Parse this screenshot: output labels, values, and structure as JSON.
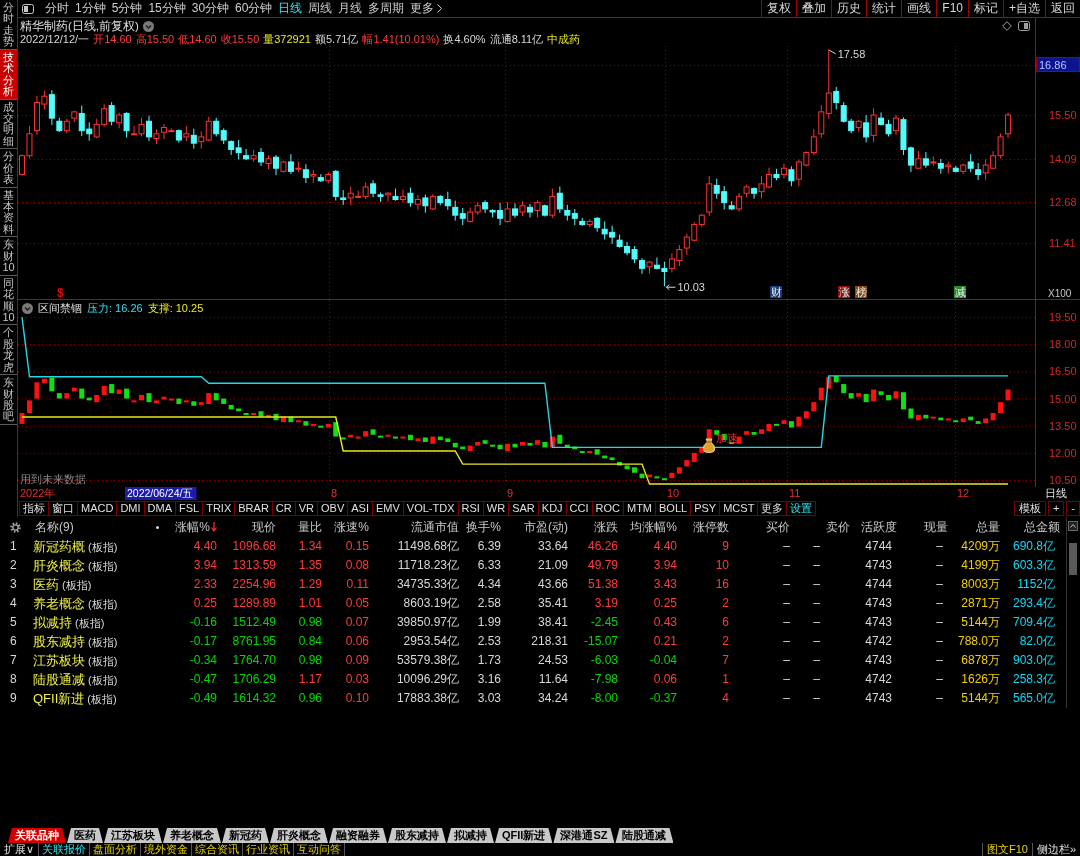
{
  "side_tabs": [
    {
      "label": "分时走势",
      "selected": false
    },
    {
      "label": "技术分析",
      "selected": true
    },
    {
      "label": "成交明细",
      "selected": false
    },
    {
      "label": "分价表",
      "selected": false
    },
    {
      "label": "基本资料",
      "selected": false
    },
    {
      "label": "东财10",
      "selected": false
    },
    {
      "label": "同花顺10",
      "selected": false
    },
    {
      "label": "个股龙虎",
      "selected": false
    },
    {
      "label": "东财股吧",
      "selected": false
    }
  ],
  "toolbar": {
    "periods": [
      {
        "label": "分时",
        "selected": false,
        "kind": "period"
      },
      {
        "label": "1分钟",
        "selected": false,
        "kind": "period"
      },
      {
        "label": "5分钟",
        "selected": false,
        "kind": "period"
      },
      {
        "label": "15分钟",
        "selected": false,
        "kind": "period"
      },
      {
        "label": "30分钟",
        "selected": false,
        "kind": "period"
      },
      {
        "label": "60分钟",
        "selected": false,
        "kind": "period"
      },
      {
        "label": "日线",
        "selected": true,
        "kind": "period"
      },
      {
        "label": "周线",
        "selected": false,
        "kind": "period"
      },
      {
        "label": "月线",
        "selected": false,
        "kind": "period"
      },
      {
        "label": "多周期",
        "selected": false,
        "kind": "period"
      },
      {
        "label": "更多",
        "selected": false,
        "kind": "menu"
      }
    ],
    "buttons": [
      "复权",
      "叠加",
      "历史",
      "统计",
      "画线",
      "F10",
      "标记",
      "+自选",
      "返回"
    ]
  },
  "quote": {
    "title": "精华制药(日线,前复权)",
    "fields": [
      {
        "text": "2022/12/12/一",
        "kind": "plain"
      },
      {
        "text": "开14.60",
        "kind": "up"
      },
      {
        "text": "高15.50",
        "kind": "up"
      },
      {
        "text": "低14.60",
        "kind": "up"
      },
      {
        "text": "收15.50",
        "kind": "up"
      },
      {
        "text": "量372921",
        "kind": "volume"
      },
      {
        "text": "额5.71亿",
        "kind": "plain"
      },
      {
        "text": "幅1.41(10.01%)",
        "kind": "up"
      },
      {
        "text": "换4.60%",
        "kind": "plain"
      },
      {
        "text": "流通8.11亿",
        "kind": "plain"
      },
      {
        "text": "中成药",
        "kind": "sector"
      }
    ]
  },
  "main_chart": {
    "axis_labels": [
      {
        "text": "16.86",
        "highlighted": true
      },
      {
        "text": "15.50",
        "highlighted": false
      },
      {
        "text": "14.09",
        "highlighted": false
      },
      {
        "text": "12.68",
        "highlighted": false
      },
      {
        "text": "11.41",
        "highlighted": false
      }
    ],
    "high_label": "17.58",
    "low_label": "10.03",
    "markers": [
      {
        "text": "$",
        "color": "#e00000",
        "kind": "glyph"
      },
      {
        "text": "财",
        "color": "#1a3c78",
        "kind": "badge"
      },
      {
        "text": "涨",
        "color": "#8a1010",
        "kind": "badge"
      },
      {
        "text": "榜",
        "color": "#8a4a10",
        "kind": "badge"
      },
      {
        "text": "减",
        "color": "#2a8a2a",
        "kind": "badge"
      }
    ],
    "scale": "X100"
  },
  "indicator": {
    "name": "区间禁锢",
    "resistance": "压力: 16.26",
    "support": "支撑: 10.25",
    "signal": "加速",
    "note": "用到未来数据",
    "axis_labels": [
      "19.50",
      "18.00",
      "16.50",
      "15.00",
      "13.50",
      "12.00",
      "10.50"
    ]
  },
  "date_axis": {
    "year": "2022年",
    "cursor": "2022/06/24/五",
    "months": [
      "8",
      "9",
      "10",
      "11",
      "12"
    ],
    "period": "日线"
  },
  "indicator_tabs": [
    {
      "label": "指标",
      "kind": "tab"
    },
    {
      "label": "窗口",
      "kind": "tab"
    },
    {
      "label": "MACD",
      "kind": "tab"
    },
    {
      "label": "DMI",
      "kind": "tab"
    },
    {
      "label": "DMA",
      "kind": "tab"
    },
    {
      "label": "FSL",
      "kind": "tab"
    },
    {
      "label": "TRIX",
      "kind": "tab"
    },
    {
      "label": "BRAR",
      "kind": "tab"
    },
    {
      "label": "CR",
      "kind": "tab"
    },
    {
      "label": "VR",
      "kind": "tab"
    },
    {
      "label": "OBV",
      "kind": "tab"
    },
    {
      "label": "ASI",
      "kind": "tab"
    },
    {
      "label": "EMV",
      "kind": "tab"
    },
    {
      "label": "VOL-TDX",
      "kind": "tab"
    },
    {
      "label": "RSI",
      "kind": "tab"
    },
    {
      "label": "WR",
      "kind": "tab"
    },
    {
      "label": "SAR",
      "kind": "tab"
    },
    {
      "label": "KDJ",
      "kind": "tab"
    },
    {
      "label": "CCI",
      "kind": "tab"
    },
    {
      "label": "ROC",
      "kind": "tab"
    },
    {
      "label": "MTM",
      "kind": "tab"
    },
    {
      "label": "BOLL",
      "kind": "tab"
    },
    {
      "label": "PSY",
      "kind": "tab"
    },
    {
      "label": "MCST",
      "kind": "tab"
    },
    {
      "label": "更多",
      "kind": "tab"
    },
    {
      "label": "设置",
      "kind": "setting"
    }
  ],
  "template_buttons": [
    "模板",
    "+",
    "-"
  ],
  "table": {
    "columns": [
      {
        "label": "名称(9)",
        "kind": "name",
        "sorted": false
      },
      {
        "label": "涨幅%",
        "kind": "trend",
        "sorted": true
      },
      {
        "label": "现价",
        "kind": "trend",
        "sorted": false
      },
      {
        "label": "量比",
        "kind": "ratio",
        "sorted": false
      },
      {
        "label": "涨速%",
        "kind": "rise",
        "sorted": false
      },
      {
        "label": "流通市值",
        "kind": "plain",
        "sorted": false
      },
      {
        "label": "换手%",
        "kind": "plain",
        "sorted": false
      },
      {
        "label": "市盈(动)",
        "kind": "plain",
        "sorted": false
      },
      {
        "label": "涨跌",
        "kind": "trend",
        "sorted": false
      },
      {
        "label": "均涨幅%",
        "kind": "avg",
        "sorted": false
      },
      {
        "label": "涨停数",
        "kind": "rise",
        "sorted": false
      },
      {
        "label": "买价",
        "kind": "plain",
        "sorted": false
      },
      {
        "label": "卖价",
        "kind": "plain",
        "sorted": false
      },
      {
        "label": "活跃度",
        "kind": "plain",
        "sorted": false
      },
      {
        "label": "现量",
        "kind": "plain",
        "sorted": false
      },
      {
        "label": "总量",
        "kind": "volume",
        "sorted": false
      },
      {
        "label": "总金额",
        "kind": "amount",
        "sorted": false
      }
    ],
    "rows": [
      {
        "no": "1",
        "name": "新冠药概",
        "tag": "(板指)",
        "up": true,
        "ratio_up": true,
        "avg_up": true,
        "values": [
          "4.40",
          "1096.68",
          "1.34",
          "0.15",
          "11498.68亿",
          "6.39",
          "33.64",
          "46.26",
          "4.40",
          "9",
          "–",
          "–",
          "4744",
          "–",
          "4209万",
          "690.8亿"
        ]
      },
      {
        "no": "2",
        "name": "肝炎概念",
        "tag": "(板指)",
        "up": true,
        "ratio_up": true,
        "avg_up": true,
        "values": [
          "3.94",
          "1313.59",
          "1.35",
          "0.08",
          "11718.23亿",
          "6.33",
          "21.09",
          "49.79",
          "3.94",
          "10",
          "–",
          "–",
          "4743",
          "–",
          "4199万",
          "603.3亿"
        ]
      },
      {
        "no": "3",
        "name": "医药",
        "tag": "(板指)",
        "up": true,
        "ratio_up": true,
        "avg_up": true,
        "values": [
          "2.33",
          "2254.96",
          "1.29",
          "0.11",
          "34735.33亿",
          "4.34",
          "43.66",
          "51.38",
          "3.43",
          "16",
          "–",
          "–",
          "4744",
          "–",
          "8003万",
          "1152亿"
        ]
      },
      {
        "no": "4",
        "name": "养老概念",
        "tag": "(板指)",
        "up": true,
        "ratio_up": true,
        "avg_up": true,
        "values": [
          "0.25",
          "1289.89",
          "1.01",
          "0.05",
          "8603.19亿",
          "2.58",
          "35.41",
          "3.19",
          "0.25",
          "2",
          "–",
          "–",
          "4743",
          "–",
          "2871万",
          "293.4亿"
        ]
      },
      {
        "no": "5",
        "name": "拟减持",
        "tag": "(板指)",
        "up": false,
        "ratio_up": false,
        "avg_up": true,
        "values": [
          "-0.16",
          "1512.49",
          "0.98",
          "0.07",
          "39850.97亿",
          "1.99",
          "38.41",
          "-2.45",
          "0.43",
          "6",
          "–",
          "–",
          "4743",
          "–",
          "5144万",
          "709.4亿"
        ]
      },
      {
        "no": "6",
        "name": "股东减持",
        "tag": "(板指)",
        "up": false,
        "ratio_up": false,
        "avg_up": true,
        "values": [
          "-0.17",
          "8761.95",
          "0.84",
          "0.06",
          "2953.54亿",
          "2.53",
          "218.31",
          "-15.07",
          "0.21",
          "2",
          "–",
          "–",
          "4742",
          "–",
          "788.0万",
          "82.0亿"
        ]
      },
      {
        "no": "7",
        "name": "江苏板块",
        "tag": "(板指)",
        "up": false,
        "ratio_up": false,
        "avg_up": false,
        "values": [
          "-0.34",
          "1764.70",
          "0.98",
          "0.09",
          "53579.38亿",
          "1.73",
          "24.53",
          "-6.03",
          "-0.04",
          "7",
          "–",
          "–",
          "4743",
          "–",
          "6878万",
          "903.0亿"
        ]
      },
      {
        "no": "8",
        "name": "陆股通减",
        "tag": "(板指)",
        "up": false,
        "ratio_up": true,
        "avg_up": true,
        "values": [
          "-0.47",
          "1706.29",
          "1.17",
          "0.03",
          "10096.29亿",
          "3.16",
          "11.64",
          "-7.98",
          "0.06",
          "1",
          "–",
          "–",
          "4742",
          "–",
          "1626万",
          "258.3亿"
        ]
      },
      {
        "no": "9",
        "name": "QFII新进",
        "tag": "(板指)",
        "up": false,
        "ratio_up": false,
        "avg_up": false,
        "values": [
          "-0.49",
          "1614.32",
          "0.96",
          "0.10",
          "17883.38亿",
          "3.03",
          "34.24",
          "-8.00",
          "-0.37",
          "4",
          "–",
          "–",
          "4743",
          "–",
          "5144万",
          "565.0亿"
        ]
      }
    ]
  },
  "board_tabs": [
    {
      "label": "关联品种",
      "selected": true
    },
    {
      "label": "医药",
      "selected": false
    },
    {
      "label": "江苏板块",
      "selected": false
    },
    {
      "label": "养老概念",
      "selected": false
    },
    {
      "label": "新冠药",
      "selected": false
    },
    {
      "label": "肝炎概念",
      "selected": false
    },
    {
      "label": "融资融券",
      "selected": false
    },
    {
      "label": "股东减持",
      "selected": false
    },
    {
      "label": "拟减持",
      "selected": false
    },
    {
      "label": "QFII新进",
      "selected": false
    },
    {
      "label": "深港通SZ",
      "selected": false
    },
    {
      "label": "陆股通减",
      "selected": false
    }
  ],
  "status_bar": {
    "expand": "扩展∨",
    "tabs": [
      {
        "label": "关联报价",
        "selected": true
      },
      {
        "label": "盘面分析",
        "selected": false
      },
      {
        "label": "境外资金",
        "selected": false
      },
      {
        "label": "综合资讯",
        "selected": false
      },
      {
        "label": "行业资讯",
        "selected": false
      },
      {
        "label": "互动问答",
        "selected": false
      }
    ],
    "right": [
      "图文F10",
      "侧边栏»"
    ]
  }
}
